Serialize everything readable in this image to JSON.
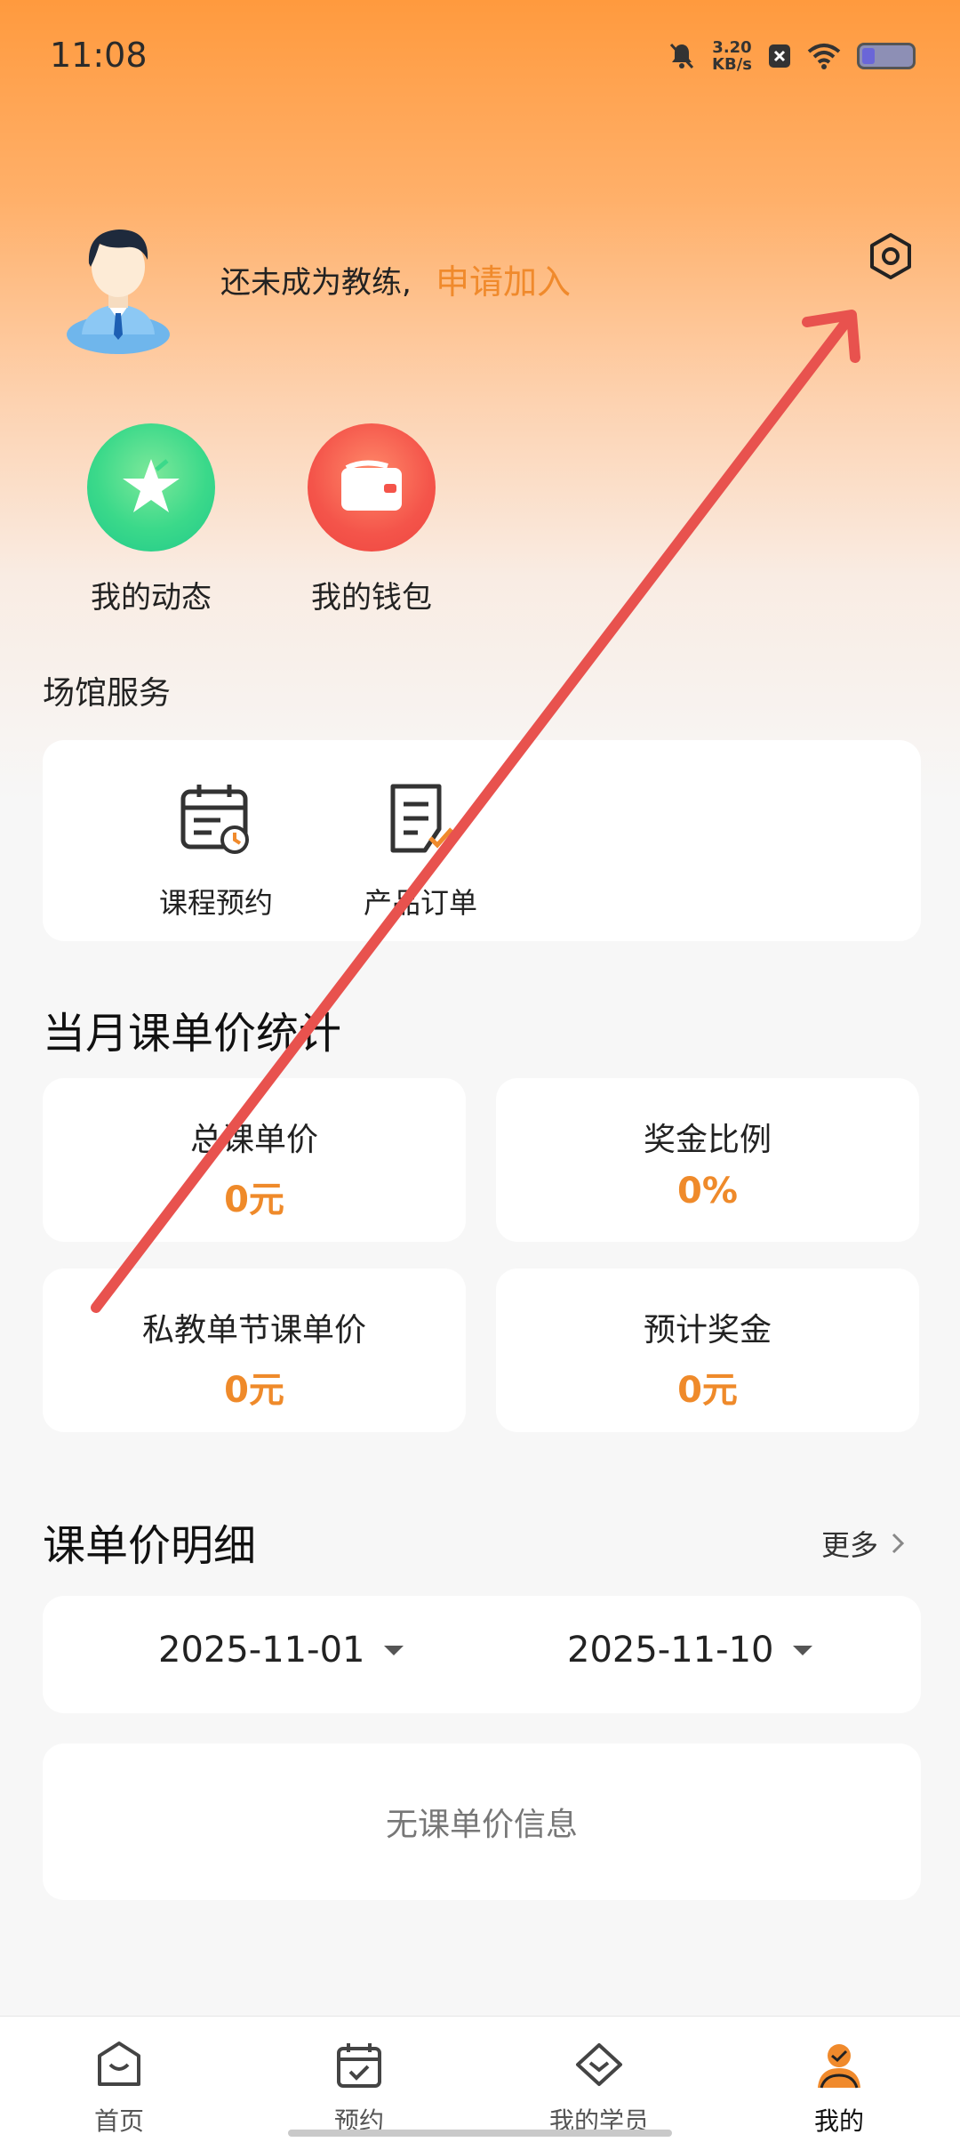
{
  "status_bar": {
    "time": "11:08",
    "speed_value": "3.20",
    "speed_unit": "KB/s"
  },
  "profile": {
    "coach_status": "还未成为教练,",
    "join_label": "申请加入"
  },
  "quick_actions": [
    {
      "label": "我的动态",
      "icon": "star-icon"
    },
    {
      "label": "我的钱包",
      "icon": "wallet-icon"
    }
  ],
  "venue_services": {
    "title": "场馆服务",
    "items": [
      {
        "label": "课程预约",
        "icon": "calendar-clock-icon"
      },
      {
        "label": "产品订单",
        "icon": "order-list-icon"
      }
    ]
  },
  "monthly_stats": {
    "title": "当月课单价统计",
    "cards": [
      {
        "label": "总课单价",
        "value": "0元"
      },
      {
        "label": "奖金比例",
        "value": "0%"
      },
      {
        "label": "私教单节课单价",
        "value": "0元"
      },
      {
        "label": "预计奖金",
        "value": "0元"
      }
    ]
  },
  "price_detail": {
    "title": "课单价明细",
    "more_label": "更多",
    "start_date": "2025-11-01",
    "end_date": "2025-11-10",
    "empty_text": "无课单价信息"
  },
  "bottom_nav": [
    {
      "label": "首页",
      "icon": "home-bag-icon",
      "active": false
    },
    {
      "label": "预约",
      "icon": "calendar-check-icon",
      "active": false
    },
    {
      "label": "我的学员",
      "icon": "heart-diamond-icon",
      "active": false
    },
    {
      "label": "我的",
      "icon": "user-icon",
      "active": true
    }
  ],
  "colors": {
    "accent": "#f08a2c",
    "annotation_arrow": "#e8524e"
  }
}
